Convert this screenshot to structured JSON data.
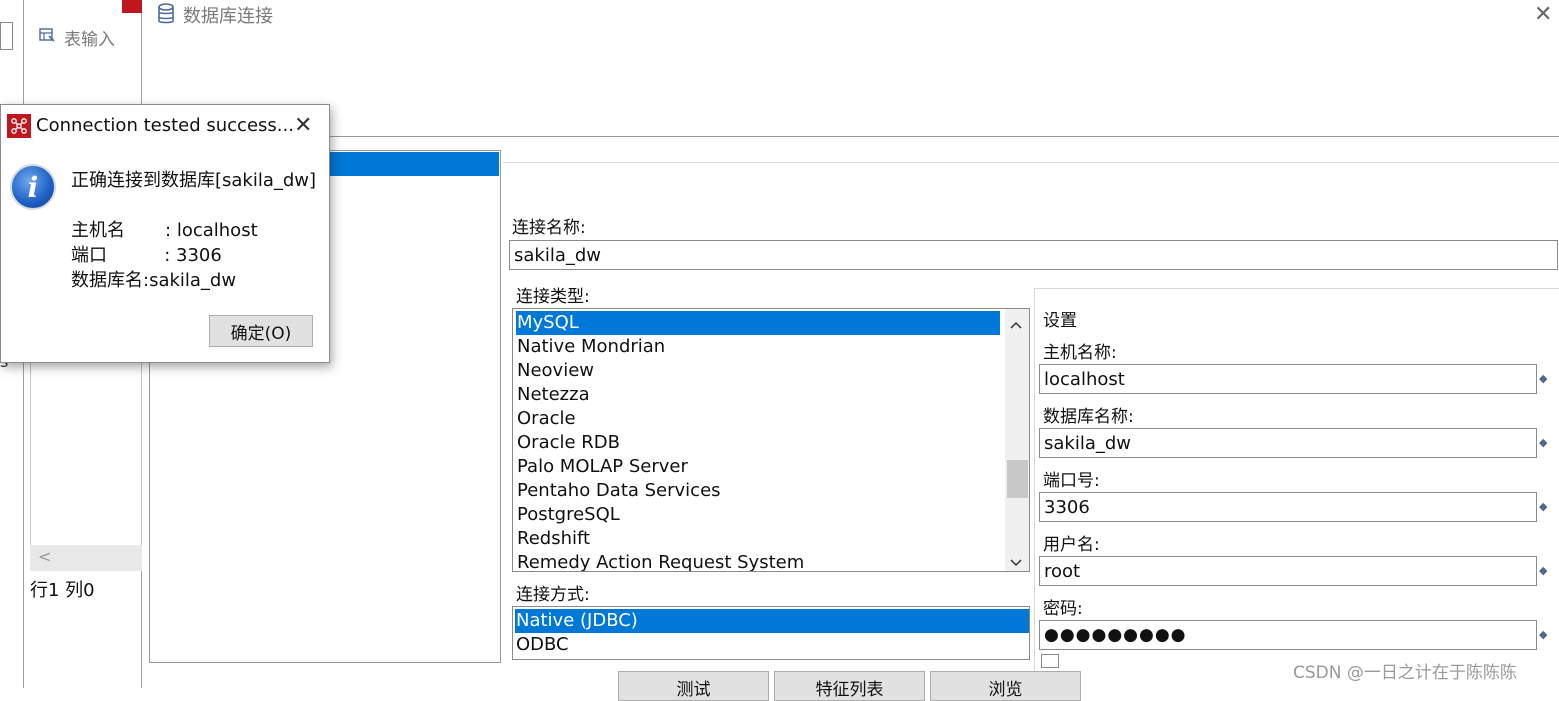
{
  "background": {
    "step_label": "表输入",
    "scroll_left": "<",
    "status": "行1 列0",
    "edge_char": "s"
  },
  "dialog": {
    "title": "数据库连接",
    "close_glyph": "✕",
    "connection_name_label": "连接名称:",
    "connection_name_value": "sakila_dw",
    "connection_type_label": "连接类型:",
    "connection_types": [
      "MySQL",
      "Native Mondrian",
      "Neoview",
      "Netezza",
      "Oracle",
      "Oracle RDB",
      "Palo MOLAP Server",
      "Pentaho Data Services",
      "PostgreSQL",
      "Redshift",
      "Remedy Action Request System"
    ],
    "selected_type": "MySQL",
    "access_label": "连接方式:",
    "access_methods": [
      "Native (JDBC)",
      "ODBC"
    ],
    "selected_access": "Native (JDBC)",
    "settings": {
      "title": "设置",
      "host_label": "主机名称:",
      "host_value": "localhost",
      "db_label": "数据库名称:",
      "db_value": "sakila_dw",
      "port_label": "端口号:",
      "port_value": "3306",
      "user_label": "用户名:",
      "user_value": "root",
      "password_label": "密码:",
      "password_value": "●●●●●●●●●"
    },
    "buttons": {
      "test": "测试",
      "features": "特征列表",
      "explore": "浏览"
    }
  },
  "popup": {
    "title": "Connection tested success...",
    "close_glyph": "✕",
    "message": "正确连接到数据库[sakila_dw]",
    "host_line": "主机名       : localhost",
    "port_line": "端口          : 3306",
    "db_line": "数据库名:sakila_dw",
    "ok_label": "确定(O)"
  },
  "watermark": "CSDN @一日之计在于陈陈陈",
  "colors": {
    "selection": "#0078d7",
    "app_icon": "#c0161d",
    "info_blue": "#1c5fc4"
  }
}
